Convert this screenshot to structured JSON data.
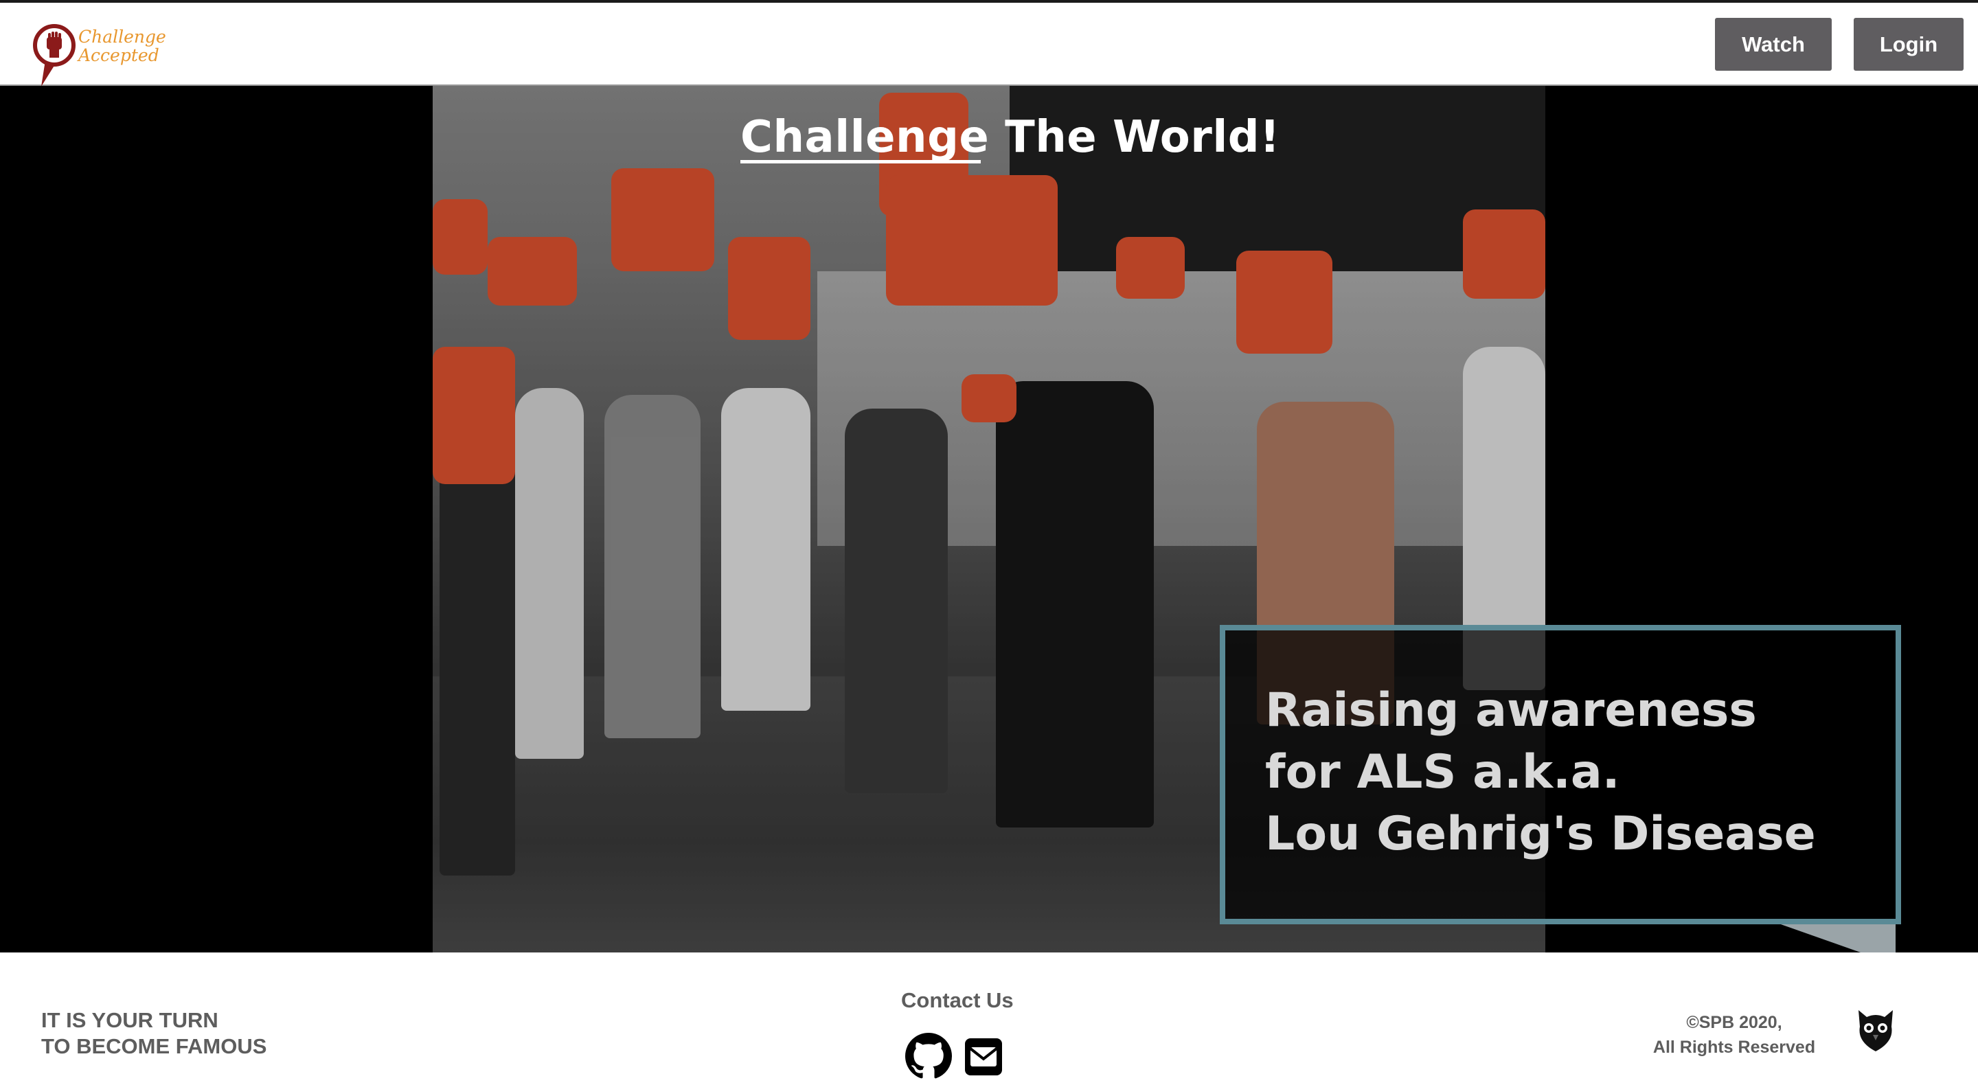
{
  "header": {
    "logo": {
      "line1": "Challenge",
      "line2": "Accepted",
      "icon": "raised-fist-pin-icon",
      "brand_color": "#8b1a1a",
      "accent_color": "#e8972e"
    },
    "watch_label": "Watch",
    "login_label": "Login",
    "button_color": "#5f5d60"
  },
  "hero": {
    "title_part1": "Challenge",
    "title_part2": "The World!",
    "caption": {
      "line1": "Raising awareness",
      "line2": "for ALS a.k.a.",
      "line3": "Lou Gehrig's Disease",
      "border_color": "#5a8a96"
    }
  },
  "footer": {
    "tagline_line1": "IT IS YOUR TURN",
    "tagline_line2": "TO BECOME FAMOUS",
    "contact_title": "Contact Us",
    "github_icon": "github-icon",
    "email_icon": "envelope-icon",
    "copyright_line1": "©SPB 2020,",
    "copyright_line2": "All Rights Reserved",
    "owl_icon": "owl-icon",
    "text_color": "#5d5d5d"
  }
}
